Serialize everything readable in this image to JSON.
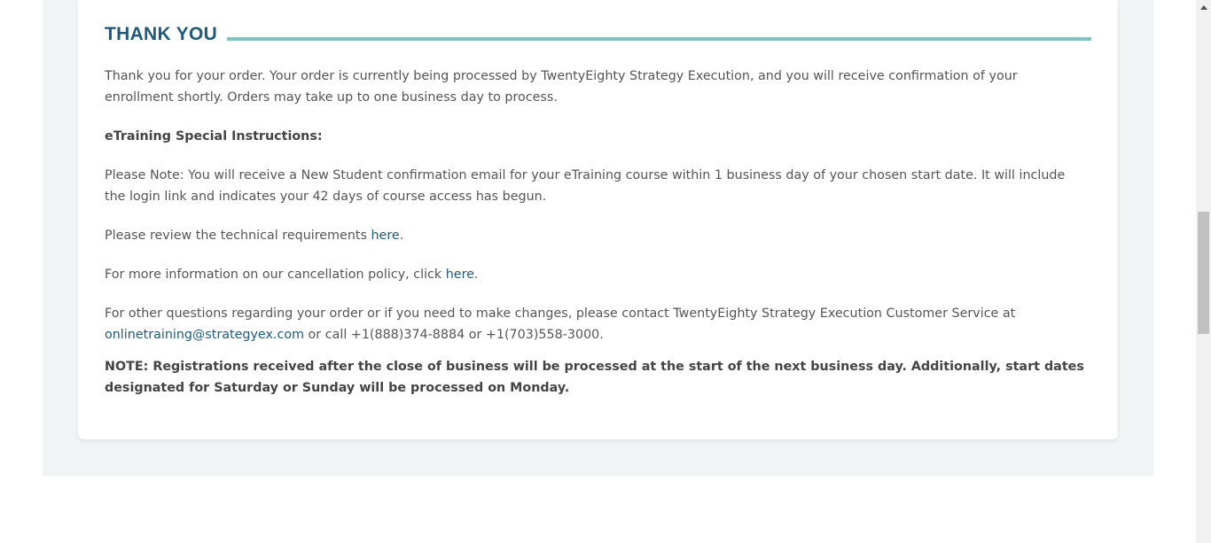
{
  "card": {
    "heading": "THANK YOU",
    "paragraph_1": "Thank you for your order. Your order is currently being processed by TwentyEighty Strategy Execution, and you will receive confirmation of your enrollment shortly. Orders may take up to one business day to process.",
    "instructions_heading": "eTraining Special Instructions:",
    "paragraph_2": "Please Note: You will receive a New Student confirmation email for your eTraining course within 1 business day of your chosen start date. It will include the login link and indicates your 42 days of course access has begun.",
    "tech_req_text": "Please review the technical requirements ",
    "tech_req_link": "here",
    "tech_req_end": ".",
    "cancel_text": "For more information on our cancellation policy, click ",
    "cancel_link": "here",
    "cancel_end": ".",
    "contact_text": "For other questions regarding your order or if you need to make changes, please contact TwentyEighty Strategy Execution Customer Service at ",
    "contact_email": "onlinetraining@strategyex.com",
    "contact_end": " or call +1(888)374-8884 or +1(703)558-3000.",
    "note": "NOTE: Registrations received after the close of business will be processed at the start of the next business day. Additionally, start dates designated for Saturday or Sunday will be processed on Monday."
  },
  "colors": {
    "heading": "#1f5a7a",
    "rule": "#7fc4c1",
    "link": "#1f5a7a",
    "panel_bg": "#f1f4f5"
  }
}
